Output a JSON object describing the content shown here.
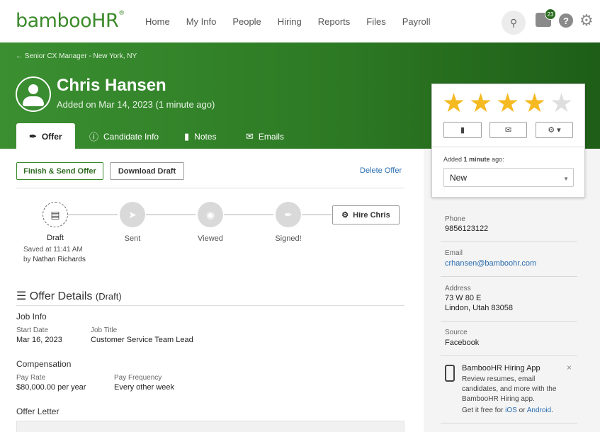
{
  "brand": {
    "logo": "bambooHR",
    "reg": "®"
  },
  "nav": {
    "items": [
      "Home",
      "My Info",
      "People",
      "Hiring",
      "Reports",
      "Files",
      "Payroll"
    ],
    "inbox_count": "23"
  },
  "header": {
    "breadcrumb": "← Senior CX Manager - New York, NY",
    "name": "Chris Hansen",
    "added": "Added on Mar 14, 2023 (1 minute ago)"
  },
  "tabs": [
    "Offer",
    "Candidate Info",
    "Notes",
    "Emails"
  ],
  "actions": {
    "finish": "Finish & Send Offer",
    "download": "Download Draft",
    "delete": "Delete Offer",
    "hire": "Hire Chris"
  },
  "progress": {
    "steps": [
      "Draft",
      "Sent",
      "Viewed",
      "Signed!"
    ],
    "saved_at": "Saved at 11:41 AM",
    "saved_by_prefix": "by",
    "saved_by": "Nathan Richards"
  },
  "offer": {
    "title": "Offer Details",
    "state": "(Draft)",
    "job_info": "Job Info",
    "start_date_label": "Start Date",
    "start_date": "Mar 16, 2023",
    "job_title_label": "Job Title",
    "job_title": "Customer Service Team Lead",
    "compensation": "Compensation",
    "pay_rate_label": "Pay Rate",
    "pay_rate": "$80,000.00 per year",
    "pay_freq_label": "Pay Frequency",
    "pay_freq": "Every other week",
    "offer_letter": "Offer Letter"
  },
  "rating": {
    "stars": 4,
    "max": 5,
    "added_prefix": "Added",
    "added_bold": "1 minute",
    "added_suffix": "ago:",
    "status": "New"
  },
  "contact": {
    "phone_label": "Phone",
    "phone": "9856123122",
    "email_label": "Email",
    "email": "crhansen@bamboohr.com",
    "address_label": "Address",
    "address1": "73 W 80 E",
    "address2": "Lindon, Utah 83058",
    "source_label": "Source",
    "source": "Facebook"
  },
  "promo": {
    "title": "BambooHR Hiring App",
    "body1": "Review resumes, email",
    "body2": "candidates, and more with the",
    "body3": "BambooHR Hiring app.",
    "cta_prefix": "Get it free for",
    "ios": "iOS",
    "or": "or",
    "android": "Android",
    "close": "×"
  },
  "colors": {
    "brand_green": "#3b8a2b",
    "star": "#f5b921",
    "link": "#2a6db0"
  }
}
